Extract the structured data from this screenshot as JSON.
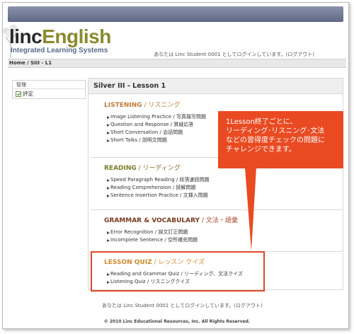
{
  "header": {
    "logo_main_linc": "linc",
    "logo_main_english": "English",
    "logo_sub": "Integrated Learning Systems",
    "login_text": "あなたは Linc Student 0001 としてログインしています。(ログアウト)"
  },
  "breadcrumb": "Home / SIII - L1",
  "sidebar": {
    "heading": "管理",
    "items": [
      {
        "label": "評定"
      }
    ]
  },
  "content": {
    "title": "Silver III - Lesson 1",
    "sections": [
      {
        "en": "LISTENING",
        "ja": " / リスニング",
        "items": [
          "Image Listening Practice / 写真描写問題",
          "Question and Response / 質疑応答",
          "Short Conversation / 会話問題",
          "Short Talks / 説明文問題"
        ]
      },
      {
        "en": "READING",
        "ja": " / リーディング",
        "items": [
          "Speed Paragraph Reading / 段落速読問題",
          "Reading Comprehension / 読解問題",
          "Sentence Insertion Practice / 文挿入問題"
        ]
      },
      {
        "en": "GRAMMAR & VOCABULARY",
        "ja": " / 文法・語彙",
        "items": [
          "Error Recognition / 誤文訂正問題",
          "Incomplete Sentence / 空所補充問題"
        ]
      },
      {
        "en": "LESSON QUIZ",
        "ja": " / レッスン クイズ",
        "items": [
          "Reading and Grammar Quiz / リーディング、文法クイズ",
          "Listening Quiz / リスニングクイズ"
        ]
      }
    ]
  },
  "callout": {
    "lines": [
      "1Lesson終了ごとに、",
      "リーディング･リスニング･文法",
      "などの習得度チェックの問題に",
      "チャレンジできます。"
    ]
  },
  "footer": {
    "login_text": "あなたは Linc Student 0001 としてログインしています。(ログアウト)",
    "copyright": "© 2010 Linc Educational Resources, Inc. All Rights Reserved."
  },
  "colors": {
    "callout": "#ea4a22",
    "topbar": "#6b738d",
    "accent_orange": "#c07a3a"
  }
}
